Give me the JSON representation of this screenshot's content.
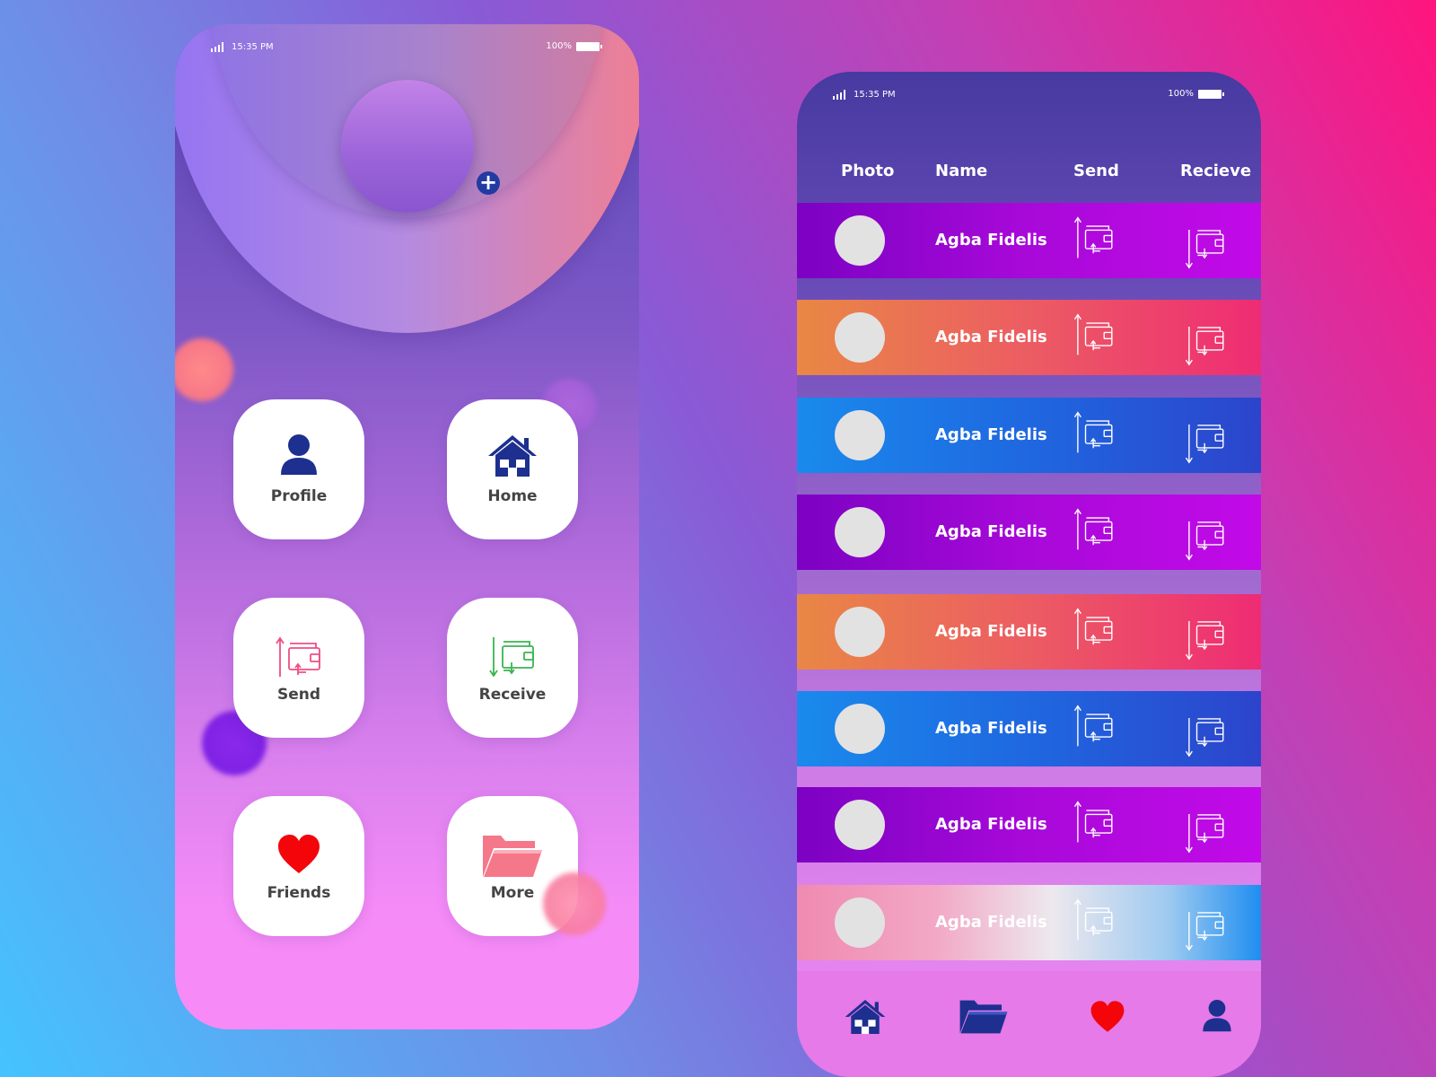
{
  "status_bar": {
    "time": "15:35 PM",
    "battery": "100%"
  },
  "left_phone": {
    "tiles": [
      {
        "label": "Profile",
        "icon": "person-icon"
      },
      {
        "label": "Home",
        "icon": "home-icon"
      },
      {
        "label": "Send",
        "icon": "wallet-send-icon"
      },
      {
        "label": "Receive",
        "icon": "wallet-receive-icon"
      },
      {
        "label": "Friends",
        "icon": "heart-icon"
      },
      {
        "label": "More",
        "icon": "folder-icon"
      }
    ]
  },
  "right_phone": {
    "headers": {
      "photo": "Photo",
      "name": "Name",
      "send": "Send",
      "receive": "Recieve"
    },
    "rows": [
      {
        "name": "Agba Fidelis",
        "style": "purple"
      },
      {
        "name": "Agba Fidelis",
        "style": "orange"
      },
      {
        "name": "Agba Fidelis",
        "style": "blue"
      },
      {
        "name": "Agba Fidelis",
        "style": "purple"
      },
      {
        "name": "Agba Fidelis",
        "style": "orange"
      },
      {
        "name": "Agba Fidelis",
        "style": "blue"
      },
      {
        "name": "Agba Fidelis",
        "style": "purple"
      },
      {
        "name": "Agba Fidelis",
        "style": "fade"
      }
    ],
    "nav": [
      "home-icon",
      "folder-icon",
      "heart-icon",
      "person-icon"
    ]
  },
  "colors": {
    "icon_blue": "#1d2f8f",
    "heart_red": "#f4050a",
    "folder_pink": "#f5778a",
    "send_pink": "#ef4d86",
    "receive_green": "#3bb452"
  }
}
